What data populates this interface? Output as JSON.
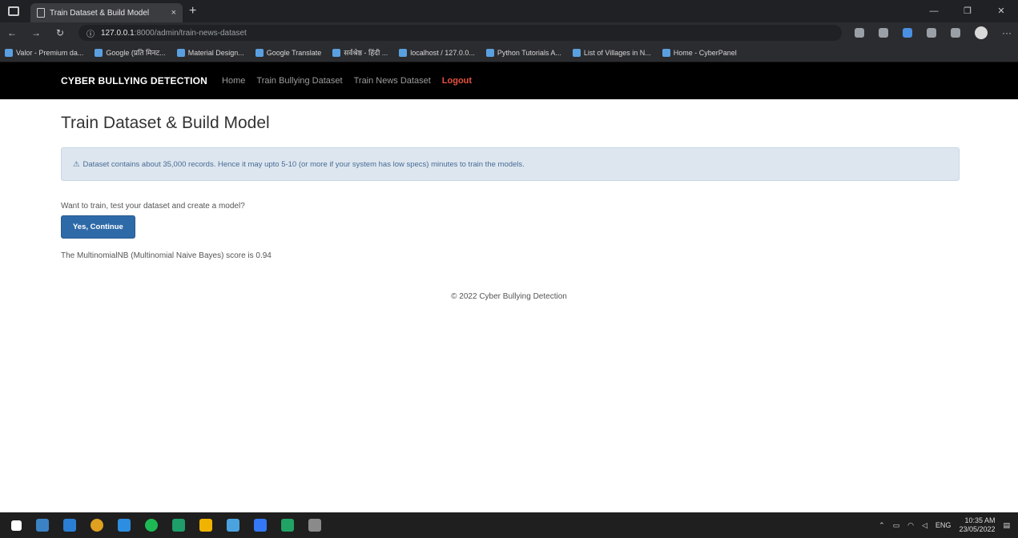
{
  "browser": {
    "tab_title": "Train Dataset & Build Model",
    "tab_close": "×",
    "new_tab": "+",
    "url_host": "127.0.0.1",
    "url_path": ":8000/admin/train-news-dataset",
    "bookmarks": [
      "Valor - Premium da...",
      "Google (प्रति मिनट...",
      "Material Design...",
      "Google Translate",
      "सर्वश्रेष्ठ - हिंदी ...",
      "localhost / 127.0.0...",
      "Python Tutorials A...",
      "List of Villages in N...",
      "Home - CyberPanel"
    ]
  },
  "navbar": {
    "brand": "CYBER BULLYING DETECTION",
    "links": [
      "Home",
      "Train Bullying Dataset",
      "Train News Dataset",
      "Logout"
    ]
  },
  "main": {
    "title": "Train Dataset & Build Model",
    "alert_icon": "⚠",
    "alert_text": "Dataset contains about 35,000 records. Hence it may upto 5-10 (or more if your system has low specs) minutes to train the models.",
    "prompt": "Want to train, test your dataset and create a model?",
    "continue_button": "Yes, Continue",
    "score_text": "The MultinomialNB (Multinomial Naive Bayes) score is 0.94",
    "footer": "© 2022 Cyber Bullying Detection"
  },
  "taskbar": {
    "time": "10:35 AM",
    "date": "23/05/2022",
    "lang": "ENG"
  },
  "colors": {
    "navbar_bg": "#000000",
    "logout": "#e8523f",
    "alert_bg": "#dde6ef",
    "button_bg": "#2f6aa8"
  }
}
